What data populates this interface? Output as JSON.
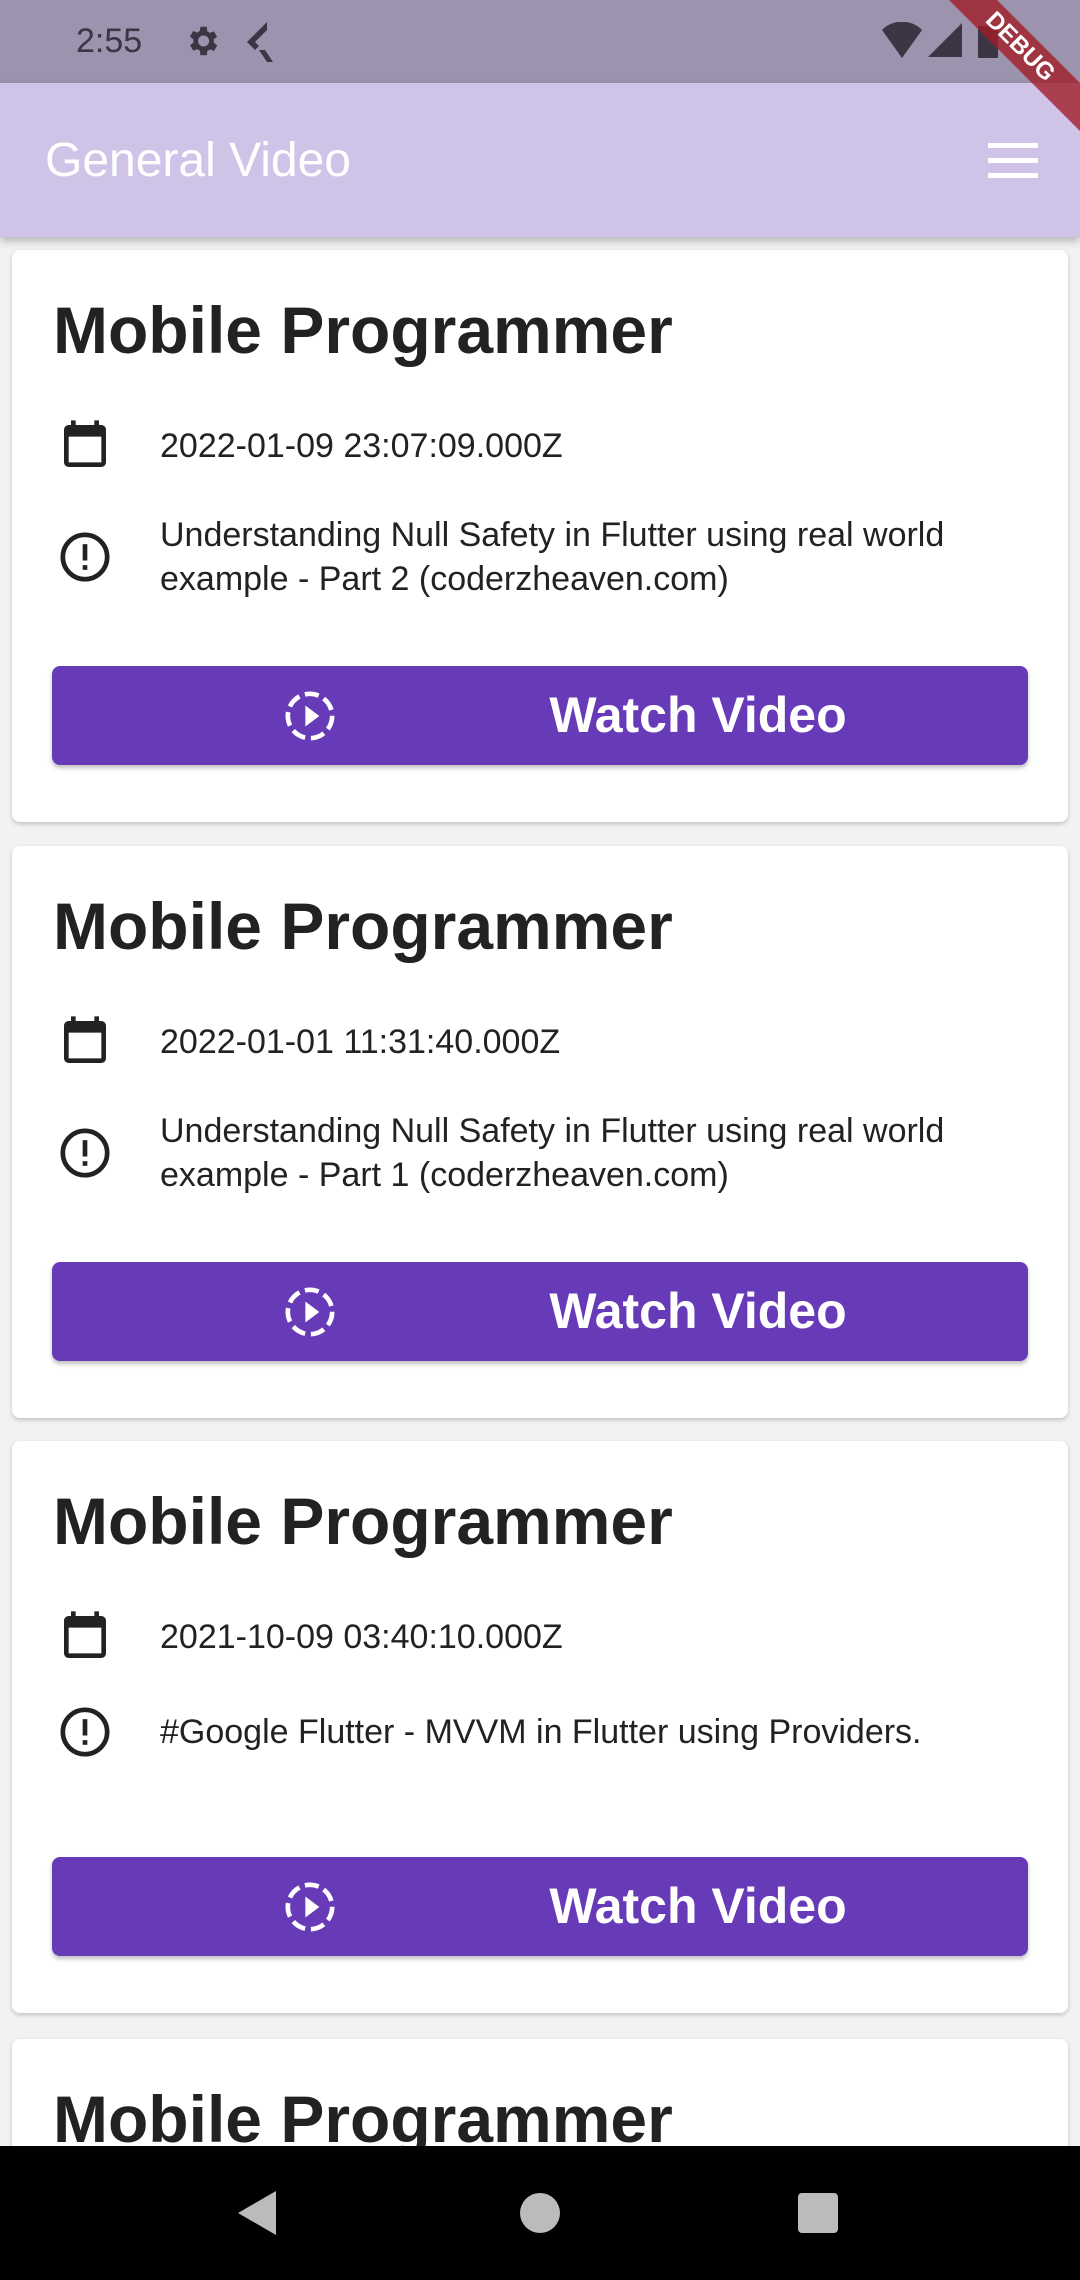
{
  "status_bar": {
    "time": "2:55"
  },
  "debug_banner": "DEBUG",
  "app_bar": {
    "title": "General Video"
  },
  "videos": [
    {
      "title": "Mobile Programmer",
      "date": "2022-01-09 23:07:09.000Z",
      "description": "Understanding Null Safety in Flutter using real world example  - Part 2 (coderzheaven.com)",
      "button": "Watch Video"
    },
    {
      "title": "Mobile Programmer",
      "date": "2022-01-01 11:31:40.000Z",
      "description": "Understanding Null Safety in Flutter using real world example  - Part 1 (coderzheaven.com)",
      "button": "Watch Video"
    },
    {
      "title": "Mobile Programmer",
      "date": "2021-10-09 03:40:10.000Z",
      "description": "#Google Flutter - MVVM in Flutter using Providers.",
      "button": "Watch Video"
    },
    {
      "title": "Mobile Programmer"
    }
  ],
  "colors": {
    "accent": "#673ab7",
    "app_bar": "#cfc4e8"
  }
}
